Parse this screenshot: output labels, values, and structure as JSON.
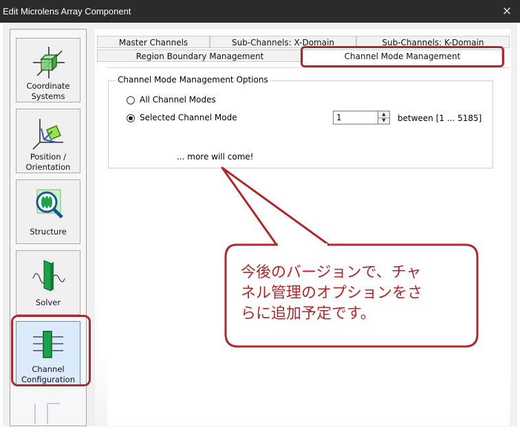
{
  "window": {
    "title": "Edit Microlens Array Component",
    "close_glyph": "✕"
  },
  "sidebar": {
    "items": [
      {
        "label": "Coordinate Systems",
        "icon": "coordinate-systems-icon",
        "line1": "Coordinate",
        "line2": "Systems"
      },
      {
        "label": "Position / Orientation",
        "icon": "position-orientation-icon",
        "line1": "Position /",
        "line2": "Orientation"
      },
      {
        "label": "Structure",
        "icon": "structure-icon",
        "line1": "Structure"
      },
      {
        "label": "Solver",
        "icon": "solver-icon",
        "line1": "Solver"
      },
      {
        "label": "Channel Configuration",
        "icon": "channel-configuration-icon",
        "line1": "Channel",
        "line2": "Configuration",
        "selected": true
      }
    ]
  },
  "tabs": {
    "row1": [
      "Master Channels",
      "Sub-Channels: X-Domain",
      "Sub-Channels: K-Domain"
    ],
    "row2": [
      "Region Boundary Management",
      "Channel Mode Management"
    ],
    "active": "Channel Mode Management"
  },
  "options": {
    "group_title": "Channel Mode Management Options",
    "radio_all": "All Channel Modes",
    "radio_selected": "Selected Channel Mode",
    "selected_value": "Selected Channel Mode",
    "mode_value": "1",
    "range_text": "between [1 ... 5185]",
    "more_text": "... more will come!"
  },
  "callout": {
    "text": "今後のバージョンで、チャネル管理のオプションをさらに追加予定です。",
    "line1": "今後のバージョンで、チャ",
    "line2": "ネル管理のオプションをさ",
    "line3": "らに追加予定です。"
  },
  "colors": {
    "highlight": "#b0272b",
    "titlebar": "#2b2b2b",
    "selected_nav": "#dcebfb"
  }
}
